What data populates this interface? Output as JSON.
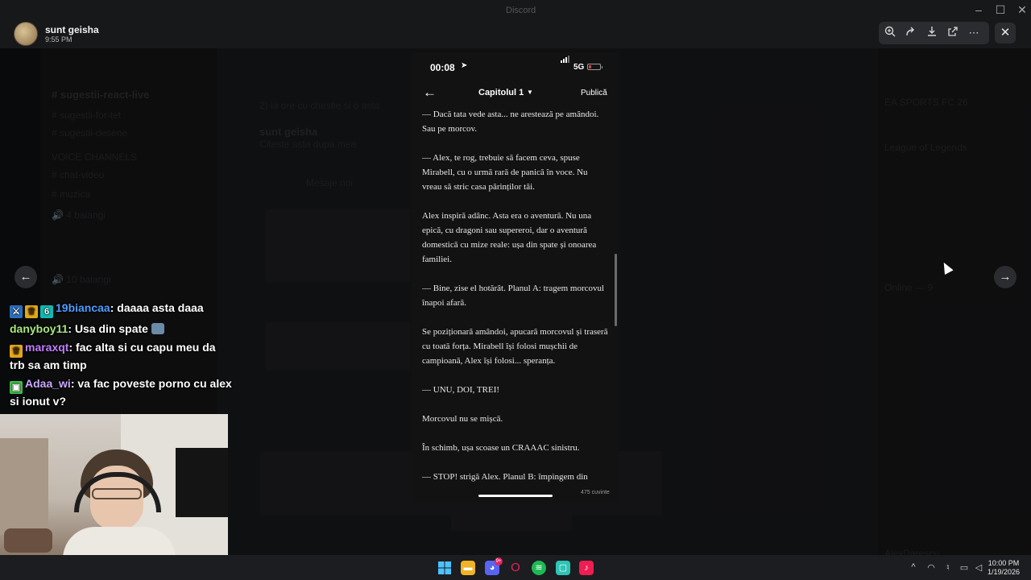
{
  "viewer": {
    "uploader_name": "sunt geisha",
    "uploader_time": "9:55 PM",
    "window_title": "Discord",
    "tools": [
      "zoom-in-icon",
      "forward-icon",
      "download-icon",
      "open-external-icon",
      "more-icon"
    ],
    "close_icon": "close-icon"
  },
  "phone": {
    "clock": "00:08",
    "network": "5G",
    "chapter_title": "Capitolul 1",
    "publish_label": "Publică",
    "word_count": "475 cuvinte",
    "paragraphs": [
      "— Dacă tata vede asta... ne arestează pe amândoi. Sau pe morcov.",
      "— Alex, te rog, trebuie să facem ceva, spuse Mirabell, cu o urmă rară de panică în voce. Nu vreau să stric casa părinților tăi.",
      "Alex inspiră adânc. Asta era o aventură. Nu una epică, cu dragoni sau supereroi, dar o aventură domestică cu mize reale: ușa din spate și onoarea familiei.",
      "— Bine, zise el hotărât. Planul A: tragem morcovul înapoi afară.",
      "Se poziționară amândoi, apucară morcovul și traseră cu toată forța. Mirabell își folosi mușchii de campioană, Alex își folosi... speranța.",
      "— UNU, DOI, TREI!",
      "Morcovul nu se mișcă.",
      "În schimb, ușa scoase un CRAAAC sinistru.",
      "— STOP! strigă Alex. Planul B: împingem din"
    ]
  },
  "chat": [
    {
      "badges": [
        "sword",
        "crown",
        "sub"
      ],
      "user": "19biancaa",
      "color": "#4f9cff",
      "text": "daaaa asta daaa"
    },
    {
      "badges": [],
      "user": "danyboy11",
      "color": "#a8e67a",
      "text": "Usa din spate"
    },
    {
      "badges": [
        "crown"
      ],
      "user": "maraxqt",
      "color": "#c27cff",
      "text": "fac alta si cu capu meu da trb sa am timp"
    },
    {
      "badges": [
        "gift"
      ],
      "user": "Adaa_wi",
      "color": "#c8a8ff",
      "text": "va fac poveste porno cu alex si ionut v?"
    }
  ],
  "taskbar": {
    "time": "10:00 PM",
    "date": "1/19/2026",
    "discord_badge": "9+",
    "apps": [
      "windows-start-icon",
      "file-explorer-icon",
      "discord-icon",
      "opera-gx-icon",
      "spotify-icon",
      "app-icon",
      "tiktok-icon"
    ]
  },
  "colors": {
    "accent_blue": "#4f9cff",
    "discord": "#5865f2",
    "spotify": "#1db954",
    "opera": "#e0245e"
  }
}
